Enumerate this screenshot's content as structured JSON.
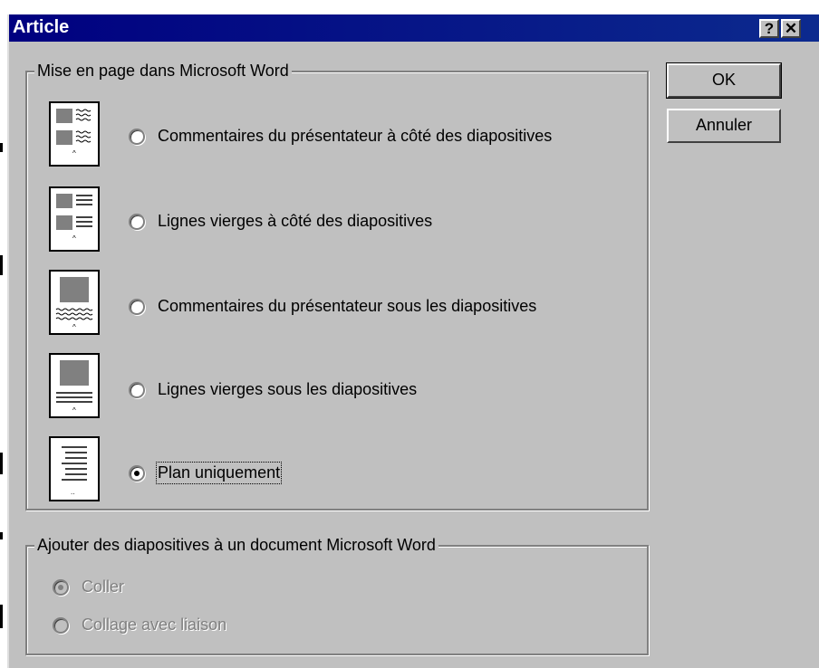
{
  "window": {
    "title": "Article"
  },
  "titlebar_buttons": {
    "help": "?",
    "close": "✕"
  },
  "buttons": {
    "ok": "OK",
    "cancel": "Annuler"
  },
  "layout_group": {
    "legend": "Mise en page dans Microsoft Word",
    "options": [
      {
        "label": "Commentaires du présentateur à côté des diapositives",
        "checked": false
      },
      {
        "label": "Lignes vierges à côté des diapositives",
        "checked": false
      },
      {
        "label": "Commentaires du présentateur sous les diapositives",
        "checked": false
      },
      {
        "label": "Lignes vierges sous les diapositives",
        "checked": false
      },
      {
        "label": "Plan uniquement",
        "checked": true
      }
    ]
  },
  "paste_group": {
    "legend": "Ajouter des diapositives à un document Microsoft Word",
    "disabled": true,
    "options": [
      {
        "label": "Coller",
        "checked": true
      },
      {
        "label": "Collage avec liaison",
        "checked": false
      }
    ]
  }
}
